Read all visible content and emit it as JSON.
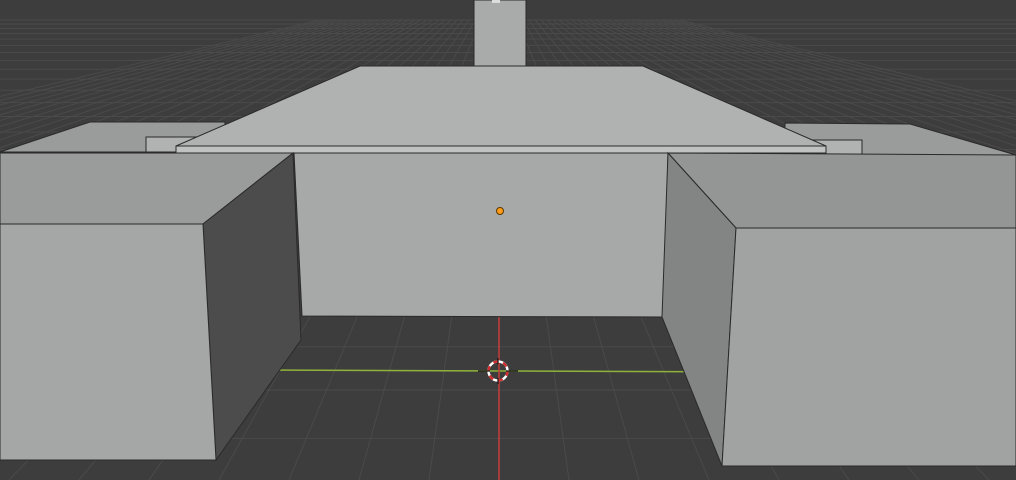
{
  "viewport": {
    "background_color": "#3d3d3d",
    "grid_line_color": "#4a4a4a",
    "axis_x_color": "#8fb33a",
    "axis_y_color": "#c83c3c",
    "object_face_light": "#a5a6a6",
    "object_face_mid": "#9a9b9b",
    "object_face_dark": "#4d4c4d",
    "object_edge_color": "#2a2a2a",
    "origin_point_color": "#ff9a1a",
    "cursor_color_a": "#d22c2c",
    "cursor_color_b": "#ffffff"
  },
  "objects": [
    {
      "name": "back-column"
    },
    {
      "name": "center-slab"
    },
    {
      "name": "back-left-block"
    },
    {
      "name": "back-right-block"
    },
    {
      "name": "front-left-cube"
    },
    {
      "name": "front-right-cube"
    }
  ],
  "icons": {
    "origin_point": "object-origin-icon",
    "cursor": "3d-cursor-icon"
  }
}
